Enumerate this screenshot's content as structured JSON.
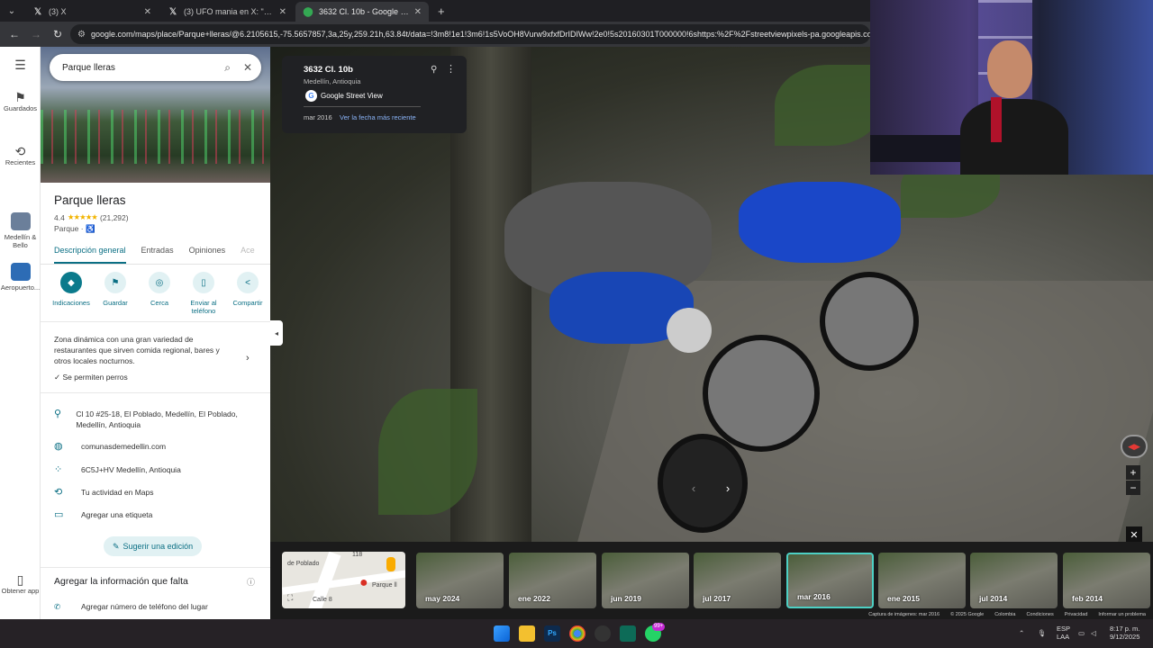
{
  "browser": {
    "tabs": [
      {
        "title": "(3) X",
        "icon": "x-logo-icon",
        "active": false
      },
      {
        "title": "(3) UFO mania en X: \"Diamond",
        "icon": "x-logo-icon",
        "active": false
      },
      {
        "title": "3632 Cl. 10b - Google Maps",
        "icon": "maps-pin-icon",
        "active": true
      }
    ],
    "url": "google.com/maps/place/Parque+lleras/@6.2105615,-75.5657857,3a,25y,259.21h,63.84t/data=!3m8!1e1!3m6!1s5VoOH8Vurw9xfxfDrIDIWw!2e0!5s20160301T000000!6shttps:%2F%2Fstreetviewpixels-pa.googleapis.com%2Fv1%2"
  },
  "rail": {
    "items": [
      {
        "label": "Guardados",
        "icon": "bookmark-icon"
      },
      {
        "label": "Recientes",
        "icon": "history-icon"
      },
      {
        "label": "Medellín & Bello",
        "icon": "city-thumbnail"
      },
      {
        "label": "Aeropuerto...",
        "icon": "airport-thumbnail"
      },
      {
        "label": "Obtener app",
        "icon": "phone-icon"
      }
    ]
  },
  "panel": {
    "search_value": "Parque lleras",
    "title": "Parque lleras",
    "rating": "4.4",
    "stars": "★★★★★",
    "reviews": "(21,292)",
    "type": "Parque ·",
    "tabs": [
      {
        "label": "Descripción general",
        "active": true
      },
      {
        "label": "Entradas",
        "active": false
      },
      {
        "label": "Opiniones",
        "active": false
      },
      {
        "label": "Ace",
        "active": false
      }
    ],
    "actions": [
      {
        "label": "Indicaciones",
        "icon": "directions-icon"
      },
      {
        "label": "Guardar",
        "icon": "bookmark-icon"
      },
      {
        "label": "Cerca",
        "icon": "nearby-icon"
      },
      {
        "label": "Enviar al teléfono",
        "icon": "send-to-phone-icon"
      },
      {
        "label": "Compartir",
        "icon": "share-icon"
      }
    ],
    "description": "Zona dinámica con una gran variedad de restaurantes que sirven comida regional, bares y otros locales nocturnos.",
    "pets": "Se permiten perros",
    "info": [
      {
        "icon": "location-pin-icon",
        "text": "Cl 10 #25-18, El Poblado, Medellín, El Poblado, Medellín, Antioquia"
      },
      {
        "icon": "globe-icon",
        "text": "comunasdemedellin.com"
      },
      {
        "icon": "plus-code-icon",
        "text": "6C5J+HV Medellín, Antioquia"
      },
      {
        "icon": "activity-history-icon",
        "text": "Tu actividad en Maps"
      },
      {
        "icon": "label-icon",
        "text": "Agregar una etiqueta"
      }
    ],
    "suggest_edit": "Sugerir una edición",
    "missing_title": "Agregar la información que falta",
    "add_phone": "Agregar número de teléfono del lugar"
  },
  "streetview": {
    "address": "3632 Cl. 10b",
    "city": "Medellín, Antioquia",
    "provider": "Google Street View",
    "date": "mar 2016",
    "latest_link": "Ver la fecha más reciente",
    "timeline": [
      {
        "label": "may 2024",
        "selected": false
      },
      {
        "label": "ene 2022",
        "selected": false
      },
      {
        "label": "jun 2019",
        "selected": false
      },
      {
        "label": "jul 2017",
        "selected": false
      },
      {
        "label": "mar 2016",
        "selected": true
      },
      {
        "label": "ene 2015",
        "selected": false
      },
      {
        "label": "jul 2014",
        "selected": false
      },
      {
        "label": "feb 2014",
        "selected": false
      }
    ],
    "minimap_labels": [
      "de Poblado",
      "Parque ll",
      "Calle 8",
      "118"
    ],
    "attribution": [
      "Captura de imágenes: mar 2016",
      "© 2025 Google",
      "Colombia",
      "Condiciones",
      "Privacidad",
      "Informar un problema"
    ]
  },
  "taskbar": {
    "lang": "ESP",
    "lang2": "LAA",
    "time": "8:17 p. m.",
    "date": "9/12/2025",
    "badge": "99+"
  }
}
